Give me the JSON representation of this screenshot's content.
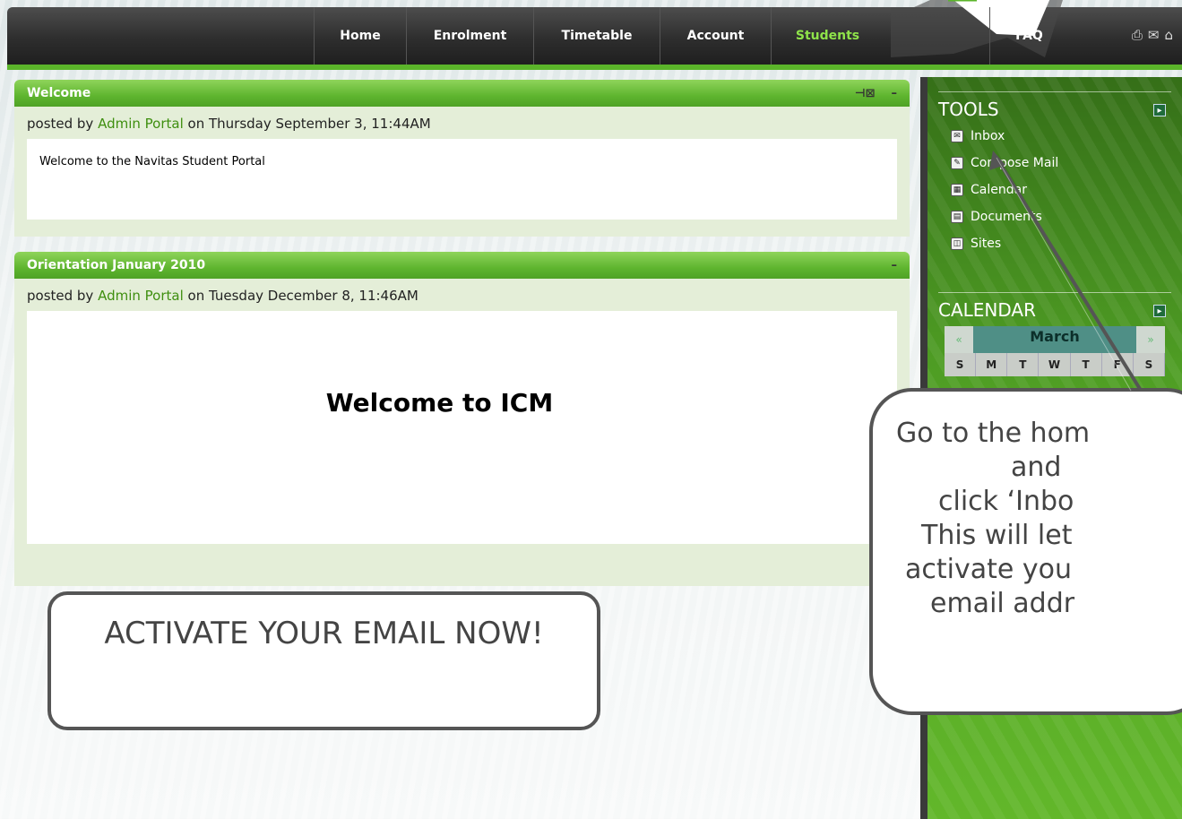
{
  "nav": {
    "items": [
      {
        "label": "Home"
      },
      {
        "label": "Enrolment"
      },
      {
        "label": "Timetable"
      },
      {
        "label": "Account"
      },
      {
        "label": "Students"
      }
    ],
    "faq_label": "FAQ",
    "icons": [
      "printer-icon",
      "mail-icon",
      "home-icon"
    ],
    "active": "Students"
  },
  "panels": [
    {
      "title": "Welcome",
      "posted_by_prefix": "posted by ",
      "author": "Admin Portal",
      "posted_on": " on Thursday September 3, 11:44AM",
      "body": "Welcome to the Navitas Student Portal"
    },
    {
      "title": "Orientation January 2010",
      "posted_by_prefix": "posted by ",
      "author": "Admin Portal",
      "posted_on": " on Tuesday December 8, 11:46AM",
      "body": "Welcome to ICM"
    }
  ],
  "sidebar": {
    "tools_title": "TOOLS",
    "tools": [
      {
        "label": "Inbox",
        "icon": "inbox-icon"
      },
      {
        "label": "Compose Mail",
        "icon": "compose-mail-icon"
      },
      {
        "label": "Calendar",
        "icon": "calendar-icon"
      },
      {
        "label": "Documents",
        "icon": "documents-icon"
      },
      {
        "label": "Sites",
        "icon": "sites-icon"
      }
    ],
    "calendar_title": "CALENDAR",
    "calendar": {
      "prev": "«",
      "month": "March",
      "next": "»",
      "days": [
        "S",
        "M",
        "T",
        "W",
        "T",
        "F",
        "S"
      ]
    }
  },
  "callouts": {
    "activate": "ACTIVATE YOUR EMAIL NOW!",
    "instructions": [
      "Go to the hom",
      "and",
      "click ‘Inbo",
      "This will let",
      "activate you",
      "email addr"
    ]
  },
  "colors": {
    "accent_green": "#5bb52a",
    "author_link": "#3f8f10",
    "nav_bg": "#2e2e2e"
  }
}
